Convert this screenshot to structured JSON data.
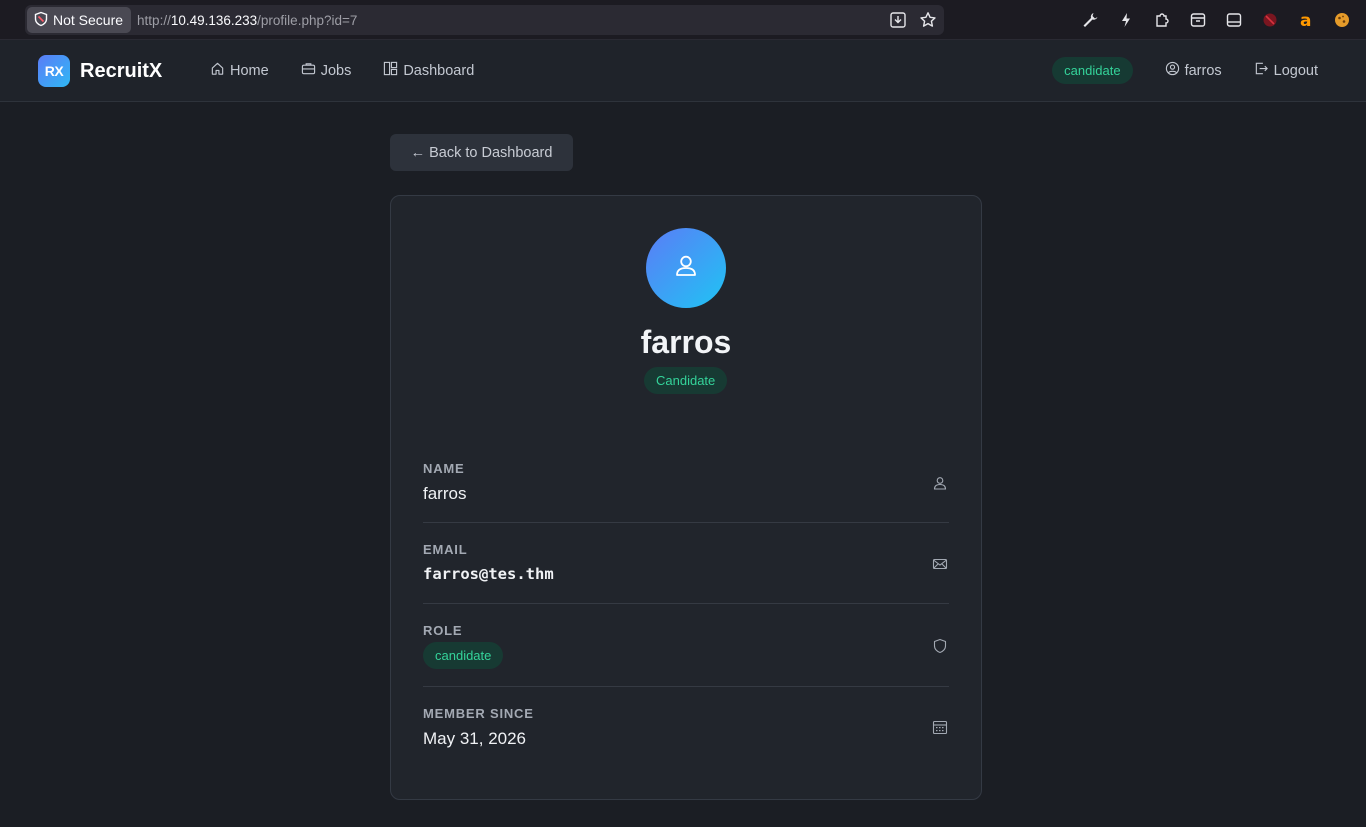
{
  "browser": {
    "security_label": "Not Secure",
    "url_prefix": "http://",
    "url_host": "10.49.136.233",
    "url_path": "/profile.php?id=7"
  },
  "navbar": {
    "logo_text": "RX",
    "brand": "RecruitX",
    "links": [
      {
        "label": "Home",
        "icon": "home-icon"
      },
      {
        "label": "Jobs",
        "icon": "briefcase-icon"
      },
      {
        "label": "Dashboard",
        "icon": "dashboard-icon"
      }
    ],
    "role_badge": "candidate",
    "username": "farros",
    "logout": "Logout"
  },
  "back_button": "← Back to Dashboard",
  "profile": {
    "name": "farros",
    "badge": "Candidate",
    "fields": {
      "name": {
        "label": "NAME",
        "value": "farros"
      },
      "email": {
        "label": "EMAIL",
        "value": "farros@tes.thm"
      },
      "role": {
        "label": "ROLE",
        "value": "candidate"
      },
      "member_since": {
        "label": "MEMBER SINCE",
        "value": "May 31, 2026"
      }
    }
  },
  "colors": {
    "accent_green": "#34d39a",
    "background": "#1b1e24",
    "card": "#21252c"
  }
}
